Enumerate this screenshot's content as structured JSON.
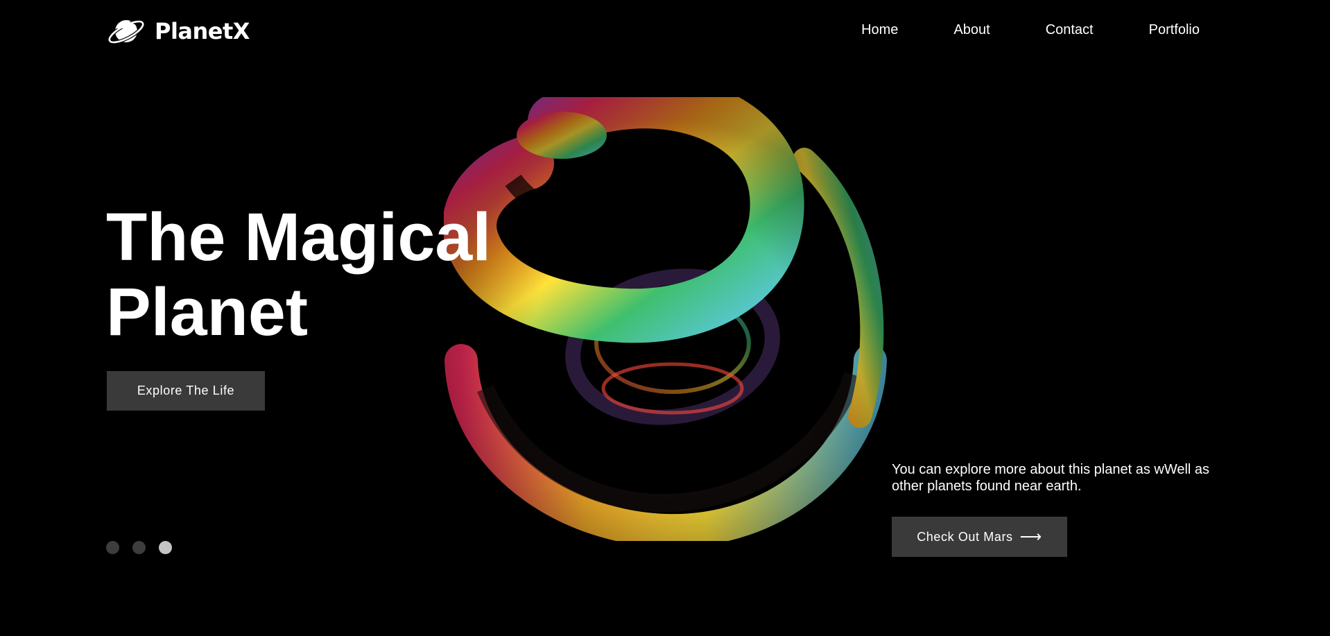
{
  "brand": {
    "name": "PlanetX",
    "icon": "planet-icon"
  },
  "nav": {
    "items": [
      {
        "label": "Home"
      },
      {
        "label": "About"
      },
      {
        "label": "Contact"
      },
      {
        "label": "Portfolio"
      }
    ]
  },
  "hero": {
    "title_line1": "The Magical",
    "title_line2": "Planet",
    "cta_label": "Explore The Life",
    "illustration": "rainbow-spiral-sphere"
  },
  "info": {
    "description": "You can explore more about this planet as wWell as other planets found near earth.",
    "cta_label": "Check Out Mars",
    "cta_arrow": "⟶"
  },
  "slider": {
    "count": 3,
    "active_index": 2
  },
  "colors": {
    "background": "#000000",
    "text": "#ffffff",
    "button": "#3a3a3a",
    "dot_inactive": "#3d3d3d",
    "dot_active": "#c4c4c4"
  }
}
